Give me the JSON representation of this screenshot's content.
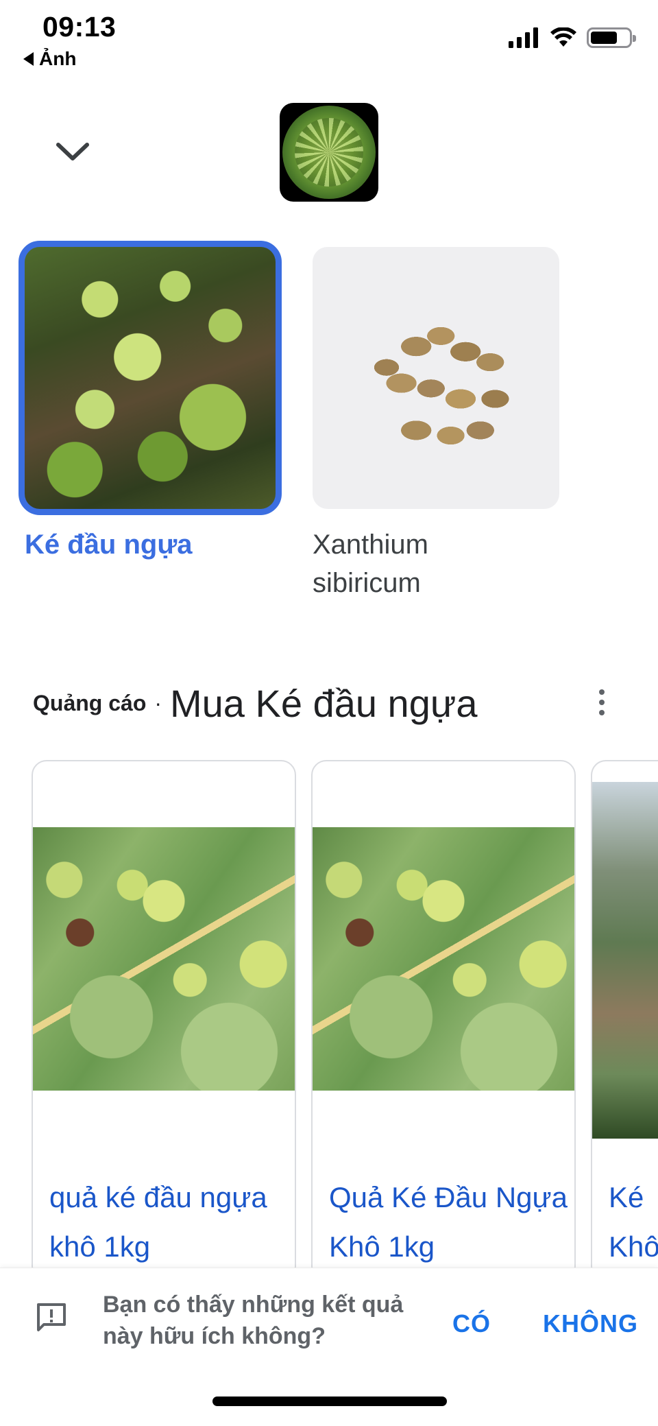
{
  "status_bar": {
    "time": "09:13",
    "back_label": "Ảnh",
    "icons": [
      "cellular-signal-icon",
      "wifi-icon",
      "battery-icon"
    ],
    "battery_level": 0.7
  },
  "header": {
    "collapse_icon": "chevron-down-icon",
    "query_thumbnail": "image-thumbnail"
  },
  "results": [
    {
      "label": "Ké đầu ngựa",
      "selected": true
    },
    {
      "label": "Xanthium sibiricum",
      "selected": false
    }
  ],
  "ads": {
    "tag": "Quảng cáo",
    "separator": "·",
    "title": "Mua Ké đầu ngựa",
    "more_icon": "more-vert-icon",
    "products": [
      {
        "title": "quả ké đầu ngựa khô 1kg"
      },
      {
        "title": "Quả Ké Đầu Ngựa Khô 1kg"
      },
      {
        "title": "Ké Khô"
      }
    ]
  },
  "feedback": {
    "icon": "feedback-icon",
    "question": "Bạn có thấy những kết quả này hữu ích không?",
    "yes_label": "CÓ",
    "no_label": "KHÔNG"
  },
  "colors": {
    "accent_blue": "#3b6ee0",
    "link_blue": "#1a56c9",
    "button_blue": "#1a73e8"
  }
}
